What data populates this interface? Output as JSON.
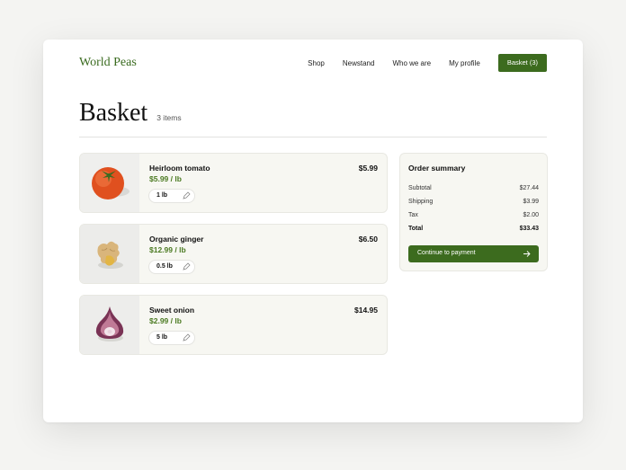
{
  "nav": {
    "logo": "World Peas",
    "links": [
      "Shop",
      "Newstand",
      "Who we are",
      "My profile"
    ],
    "basket_label": "Basket (3)"
  },
  "header": {
    "title": "Basket",
    "count": "3 items"
  },
  "items": [
    {
      "name": "Heirloom tomato",
      "unit_price": "$5.99 / lb",
      "price": "$5.99",
      "qty": "1 lb",
      "image": "tomato"
    },
    {
      "name": "Organic ginger",
      "unit_price": "$12.99 / lb",
      "price": "$6.50",
      "qty": "0.5 lb",
      "image": "ginger"
    },
    {
      "name": "Sweet onion",
      "unit_price": "$2.99 / lb",
      "price": "$14.95",
      "qty": "5 lb",
      "image": "onion"
    }
  ],
  "summary": {
    "title": "Order summary",
    "rows": [
      {
        "label": "Subtotal",
        "value": "$27.44"
      },
      {
        "label": "Shipping",
        "value": "$3.99"
      },
      {
        "label": "Tax",
        "value": "$2.00"
      },
      {
        "label": "Total",
        "value": "$33.43"
      }
    ],
    "cta": "Continue to payment"
  },
  "colors": {
    "brand": "#3c6b1e",
    "unit_price": "#4b7a22",
    "card_bg": "#f7f7f2"
  },
  "icons": {
    "edit": "pencil-icon",
    "arrow": "arrow-right-icon"
  }
}
